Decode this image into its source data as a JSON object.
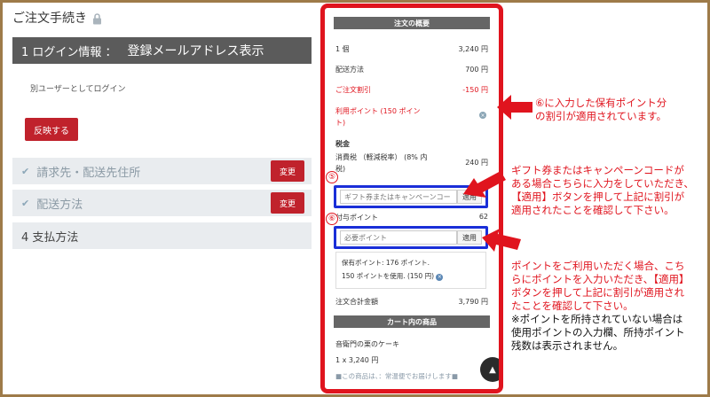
{
  "left": {
    "title": "ご注文手続き",
    "step1": {
      "label": "1 ログイン情報 ：",
      "email": "登録メールアドレス表示"
    },
    "other_user_link": "別ユーザーとしてログイン",
    "apply_button": "反映する",
    "steps": [
      {
        "label": "請求先・配送先住所",
        "change": "変更"
      },
      {
        "label": "配送方法",
        "change": "変更"
      },
      {
        "label": "4  支払方法"
      }
    ]
  },
  "summary": {
    "header": "注文の概要",
    "rows": {
      "qty": {
        "label": "1 個",
        "value": "3,240 円"
      },
      "shipping": {
        "label": "配送方法",
        "value": "700 円"
      },
      "discount": {
        "label": "ご注文割引",
        "value": "-150 円"
      },
      "points_used_line1": "利用ポイント (150 ポイン",
      "points_used_line2": "ト)",
      "tax_heading": "税金",
      "tax_line1": "消費税 （軽減税率） (8% 内",
      "tax_line2": "税)",
      "tax_value": "240 円",
      "grant_label": "付与ポイント",
      "grant_value": "62"
    },
    "gift_input": {
      "placeholder": "ギフト券またはキャンペーンコード",
      "button": "適用"
    },
    "points_input": {
      "placeholder": "必要ポイント",
      "button": "適用"
    },
    "owned_points": "保有ポイント: 176 ポイント.",
    "used_points": "150 ポイントを使用. (150 円)",
    "total": {
      "label": "注文合計金額",
      "value": "3,790 円"
    },
    "cart_header": "カート内の商品",
    "item_name": "音衛門の栗のケーキ",
    "item_qty": "1 x 3,240 円",
    "item_note": "■この商品は、：常温便でお届けします■",
    "marker5": "⑤",
    "marker6": "⑥"
  },
  "annotations": {
    "note1_line1": "⑥に入力した保有ポイント分",
    "note1_line2": "の割引が適用されています。",
    "note2_line1": "ギフト券またはキャンペーンコードが",
    "note2_line2": "ある場合こちらに入力をしていただき、",
    "note2_line3": "【適用】ボタンを押して上記に割引が",
    "note2_line4": "適用されたことを確認して下さい。",
    "note3_line1": "ポイントをご利用いただく場合、こち",
    "note3_line2": "らにポイントを入力いただき、【適用】",
    "note3_line3": "ボタンを押して上記に割引が適用され",
    "note3_line4": "たことを確認して下さい。",
    "note3_line5": "※ポイントを所持されていない場合は",
    "note3_line6": "使用ポイントの入力欄、所持ポイント",
    "note3_line7": "残数は表示されません。"
  },
  "colors": {
    "accent_red": "#e0141e",
    "button_red": "#c0222c",
    "highlight_blue": "#1a2fd8",
    "frame_brown": "#9e7b49"
  }
}
